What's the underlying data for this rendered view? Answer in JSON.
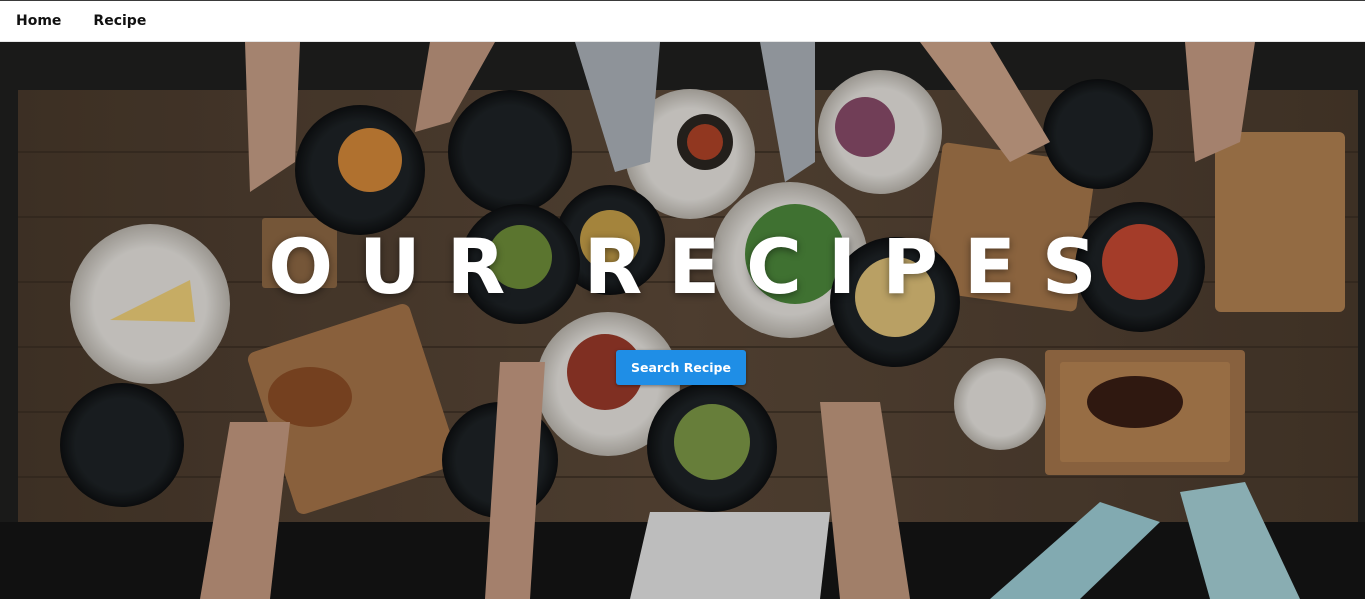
{
  "nav": {
    "items": [
      {
        "label": "Home"
      },
      {
        "label": "Recipe"
      }
    ]
  },
  "hero": {
    "title": "OUR RECIPES",
    "button_label": "Search Recipe",
    "background": "overhead photo of a wooden dining table covered with plates of food and diners' hands"
  },
  "colors": {
    "nav_bg": "#ffffff",
    "button_bg": "#1f8ee6",
    "title_color": "#ffffff",
    "table_wood": "#5a4636"
  }
}
